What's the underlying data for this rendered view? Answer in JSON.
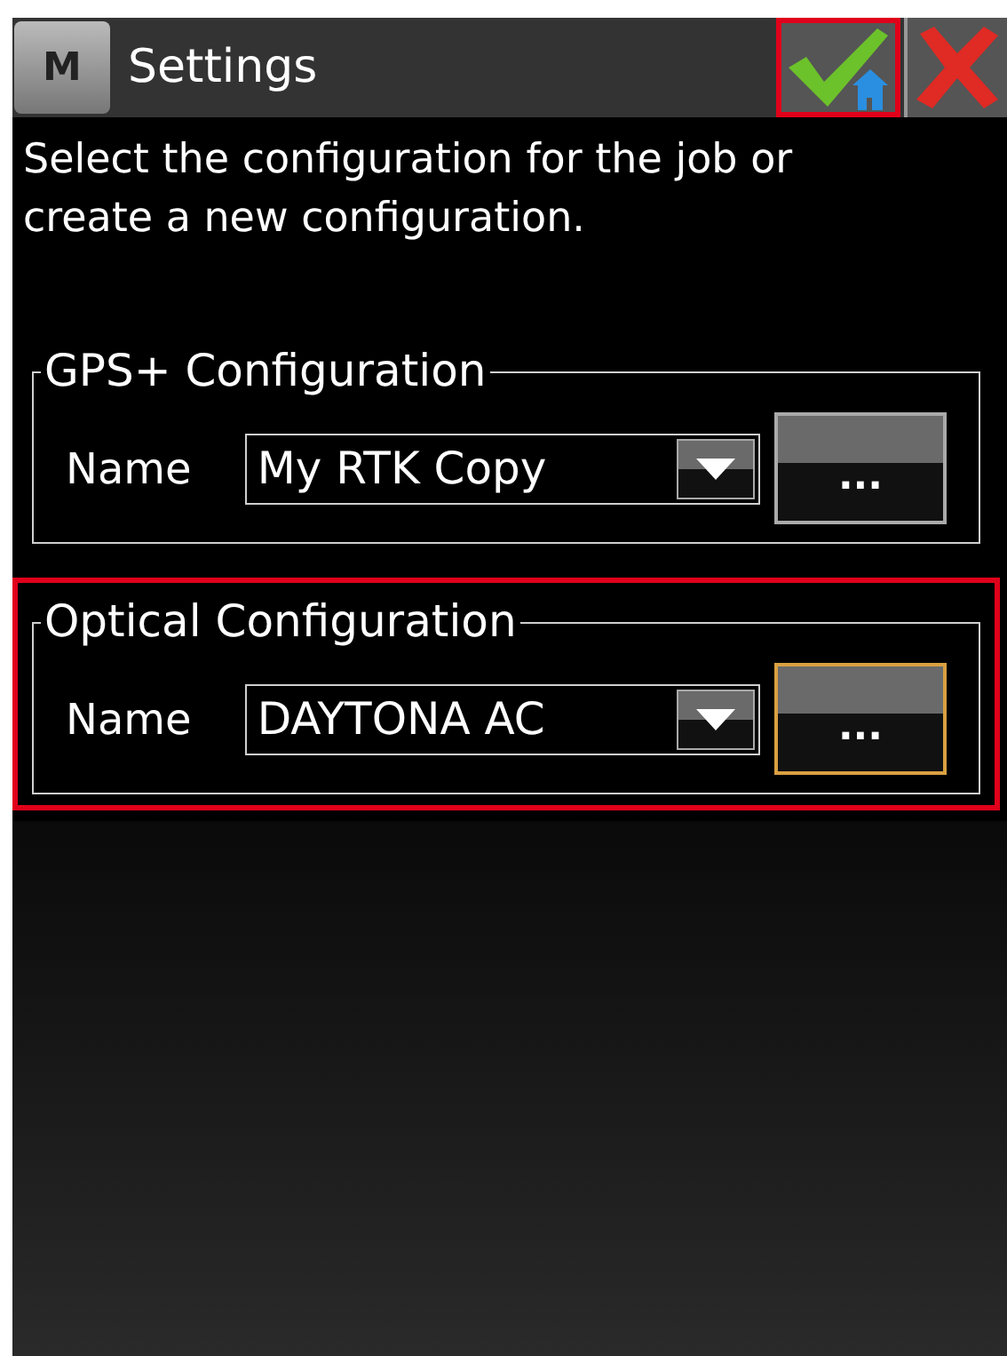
{
  "title_bar": {
    "menu_button": "M",
    "title": "Settings",
    "ok_button": {
      "highlighted": true
    },
    "cancel_button": {
      "highlighted": false
    }
  },
  "instruction": "Select the configuration for the job or create a new configuration.",
  "sections": [
    {
      "legend": "GPS+ Configuration",
      "label": "Name",
      "value": "My RTK Copy",
      "more_button": "...",
      "focused": false,
      "highlighted": false
    },
    {
      "legend": "Optical Configuration",
      "label": "Name",
      "value": "DAYTONA AC",
      "more_button": "...",
      "focused": true,
      "highlighted": true
    }
  ]
}
